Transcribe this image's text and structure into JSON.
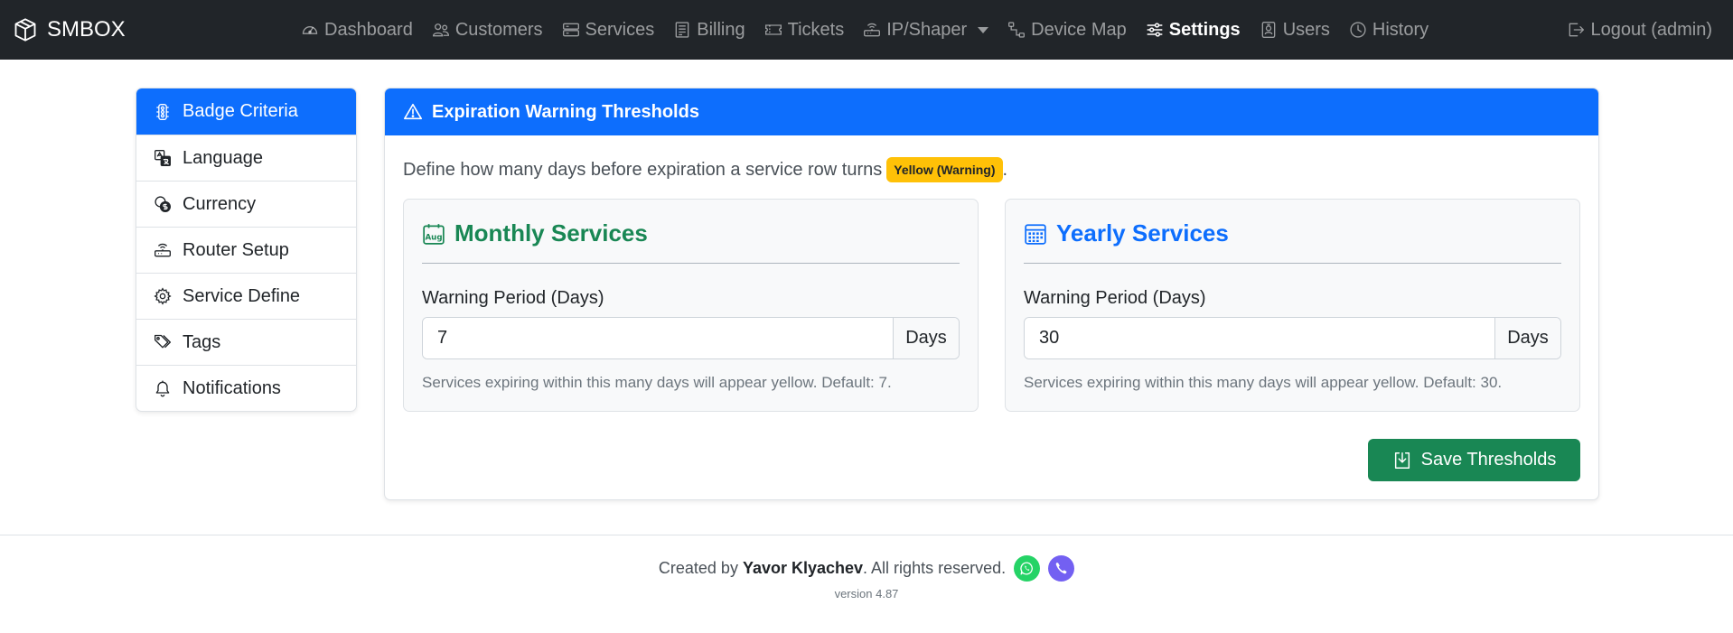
{
  "brand": {
    "name": "SMBOX"
  },
  "nav": {
    "items": [
      {
        "label": "Dashboard"
      },
      {
        "label": "Customers"
      },
      {
        "label": "Services"
      },
      {
        "label": "Billing"
      },
      {
        "label": "Tickets"
      },
      {
        "label": "IP/Shaper"
      },
      {
        "label": "Device Map"
      },
      {
        "label": "Settings",
        "active": true
      },
      {
        "label": "Users"
      },
      {
        "label": "History"
      }
    ],
    "logout_label": "Logout (admin)"
  },
  "sidebar": {
    "items": [
      {
        "label": "Badge Criteria",
        "active": true
      },
      {
        "label": "Language"
      },
      {
        "label": "Currency"
      },
      {
        "label": "Router Setup"
      },
      {
        "label": "Service Define"
      },
      {
        "label": "Tags"
      },
      {
        "label": "Notifications"
      }
    ]
  },
  "card": {
    "title": "Expiration Warning Thresholds",
    "description": "Define how many days before expiration a service row turns",
    "badge": "Yellow (Warning)",
    "description_end": ".",
    "monthly": {
      "title": "Monthly Services",
      "icon_text": "Aug",
      "label": "Warning Period (Days)",
      "value": "7",
      "unit": "Days",
      "help": "Services expiring within this many days will appear yellow. Default: 7."
    },
    "yearly": {
      "title": "Yearly Services",
      "label": "Warning Period (Days)",
      "value": "30",
      "unit": "Days",
      "help": "Services expiring within this many days will appear yellow. Default: 30."
    },
    "save_label": "Save Thresholds"
  },
  "footer": {
    "created_by": "Created by",
    "author": "Yavor Klyachev",
    "rights": ". All rights reserved.",
    "version": "version 4.87"
  },
  "colors": {
    "navbar": "#212529",
    "primary": "#0d6efd",
    "success": "#198754",
    "warning": "#ffc107",
    "whatsapp": "#25d366",
    "viber": "#7360f2"
  }
}
